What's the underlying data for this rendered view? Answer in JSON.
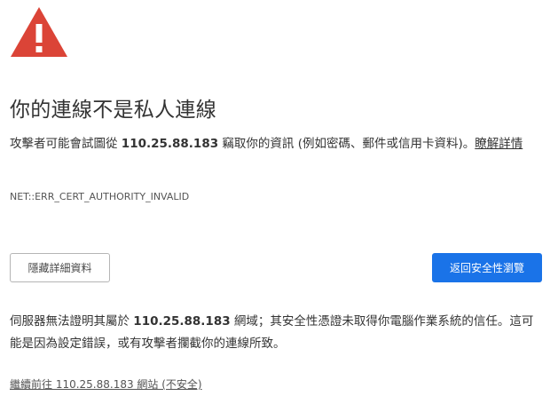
{
  "colors": {
    "warning_red": "#db4437",
    "primary_blue": "#1a73e8",
    "text": "#333333"
  },
  "icon": {
    "name": "warning-triangle-icon",
    "glyph": "!"
  },
  "headline": "你的連線不是私人連線",
  "description": {
    "before": "攻擊者可能會試圖從 ",
    "host": "110.25.88.183",
    "after": " 竊取你的資訊 (例如密碼、郵件或信用卡資料)。",
    "learn_more": "瞭解詳情"
  },
  "error_code": "NET::ERR_CERT_AUTHORITY_INVALID",
  "buttons": {
    "hide_details": "隱藏詳細資料",
    "back_to_safety": "返回安全性瀏覽"
  },
  "details": {
    "before": "伺服器無法證明其屬於 ",
    "host": "110.25.88.183",
    "after": " 網域；其安全性憑證未取得你電腦作業系統的信任。這可能是因為設定錯誤，或有攻擊者攔截你的連線所致。"
  },
  "proceed_link": "繼續前往 110.25.88.183 網站 (不安全)"
}
